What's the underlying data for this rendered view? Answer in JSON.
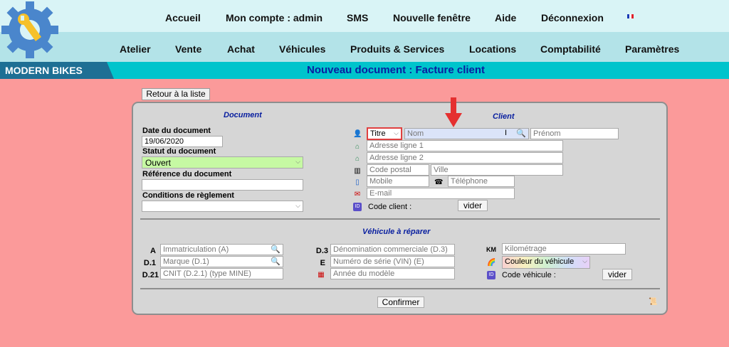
{
  "top_nav": [
    "Accueil",
    "Mon compte : admin",
    "SMS",
    "Nouvelle fenêtre",
    "Aide",
    "Déconnexion"
  ],
  "main_nav": [
    "Atelier",
    "Vente",
    "Achat",
    "Véhicules",
    "Produits & Services",
    "Locations",
    "Comptabilité",
    "Paramètres"
  ],
  "brand": "MODERN BIKES",
  "page_title": "Nouveau document : Facture client",
  "back_button": "Retour à la liste",
  "document": {
    "title": "Document",
    "date_label": "Date du document",
    "date_value": "19/06/2020",
    "status_label": "Statut du document",
    "status_value": "Ouvert",
    "reference_label": "Référence du document",
    "reference_value": "",
    "payment_label": "Conditions de règlement",
    "payment_value": ""
  },
  "client": {
    "title": "Client",
    "title_select": "Titre",
    "nom_placeholder": "Nom",
    "prenom_placeholder": "Prénom",
    "address1_placeholder": "Adresse ligne 1",
    "address2_placeholder": "Adresse ligne 2",
    "postal_placeholder": "Code postal",
    "city_placeholder": "Ville",
    "mobile_placeholder": "Mobile",
    "phone_placeholder": "Téléphone",
    "email_placeholder": "E-mail",
    "code_label": "Code client :",
    "view_button": "vider"
  },
  "vehicle": {
    "title": "Véhicule à réparer",
    "a_label": "A",
    "a_placeholder": "Immatriculation (A)",
    "d1_label": "D.1",
    "d1_placeholder": "Marque (D.1)",
    "d21_label": "D.21",
    "d21_placeholder": "CNIT (D.2.1) (type MINE)",
    "d3_label": "D.3",
    "d3_placeholder": "Dénomination commerciale (D.3)",
    "e_label": "E",
    "e_placeholder": "Numéro de série (VIN) (E)",
    "year_placeholder": "Année du modèle",
    "km_label": "KM",
    "km_placeholder": "Kilométrage",
    "color_value": "Couleur du véhicule",
    "code_label": "Code véhicule :",
    "view_button": "vider"
  },
  "confirm_button": "Confirmer",
  "colors": {
    "page_bg": "#fb9a9a",
    "topbar": "#d9f4f6",
    "navbar": "#b3e3e8",
    "brandbar": "#00c4cc",
    "brand_bg": "#1e6f94",
    "title": "#0a20a0"
  }
}
